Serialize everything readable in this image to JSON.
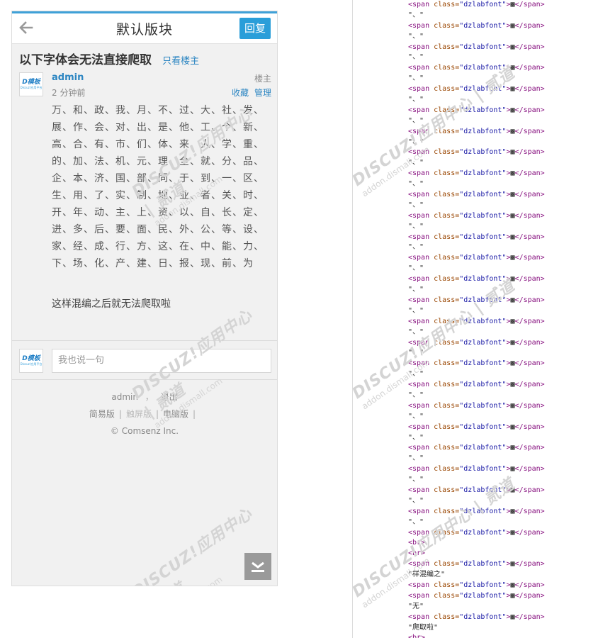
{
  "phone": {
    "header": {
      "forum_title": "默认版块",
      "reply_label": "回复"
    },
    "thread": {
      "title": "以下字体会无法直接爬取",
      "only_op_label": "只看楼主"
    },
    "post": {
      "author": "admin",
      "time": "2 分钟前",
      "floor": "楼主",
      "actions": [
        "收藏",
        "管理"
      ],
      "char_rows": [
        "万、和、政、我、月、不、过、大、社、发、",
        "展、作、会、对、出、是、他、工、个、新、",
        "高、合、有、市、们、体、来、人、学、重、",
        "的、加、法、机、元、理、全、就、分、品、",
        "企、本、济、国、部、同、于、到、一、区、",
        "生、用、了、实、制、地、业、者、关、时、",
        "开、年、动、主、上、资、以、自、长、定、",
        "进、多、后、要、面、民、外、公、等、设、",
        "家、经、成、行、方、这、在、中、能、力、",
        "下、场、化、产、建、日、报、现、前、为"
      ],
      "tail": "这样混编之后就无法爬取啦"
    },
    "comment": {
      "placeholder": "我也说一句"
    },
    "footer": {
      "user": "admin",
      "comma": "，",
      "logout": "退出",
      "links": [
        "简易版",
        "触屏版",
        "电脑版"
      ],
      "copyright": "© Comsenz Inc."
    },
    "avatar_logo": {
      "main": "D模板",
      "sub": "Discuz!应用平台"
    },
    "watermark": {
      "line1": "DISCUZ!应用中心 | 贰道",
      "line2": "addon.dismall.com"
    }
  },
  "code_view": {
    "span_open": "<span class=\"dzlabfont\">",
    "glyph": "▩",
    "span_close": "</span>",
    "sep_line": "\"、\"",
    "br": "<br>",
    "text_1": "\"样混编之\"",
    "text_2": "\"无\"",
    "text_3": "\"爬取啦\""
  },
  "colors": {
    "accent": "#2a9ed9",
    "link": "#2d86c2",
    "header_border": "#3fa1d8"
  }
}
